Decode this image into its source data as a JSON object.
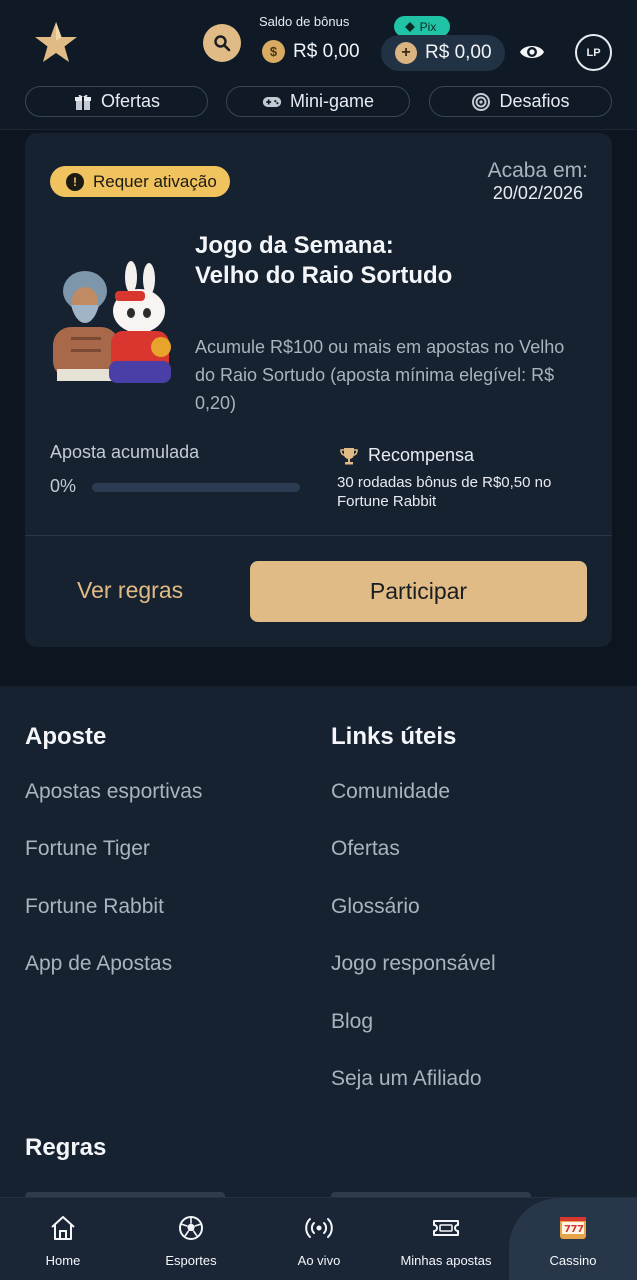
{
  "header": {
    "bonus_label": "Saldo de bônus",
    "bonus_value": "R$ 0,00",
    "pix_label": "Pix",
    "balance_value": "R$ 0,00",
    "avatar_initials": "LP",
    "tabs": [
      {
        "label": "Ofertas",
        "icon": "gift-icon"
      },
      {
        "label": "Mini-game",
        "icon": "gamepad-icon"
      },
      {
        "label": "Desafios",
        "icon": "target-icon"
      }
    ]
  },
  "card": {
    "status_badge": "Requer ativação",
    "ends_label": "Acaba em:",
    "ends_date": "20/02/2026",
    "title_line1": "Jogo da Semana:",
    "title_line2": "Velho do Raio Sortudo",
    "description": "Acumule R$100 ou mais em apostas no Velho do Raio Sortudo (aposta mínima elegível: R$ 0,20)",
    "accumulated_label": "Aposta acumulada",
    "progress_text": "0%",
    "progress_fraction": 0,
    "reward_label": "Recompensa",
    "reward_text": "30 rodadas bônus de R$0,50 no Fortune Rabbit",
    "rules_link": "Ver regras",
    "join_button": "Participar"
  },
  "footer": {
    "col1_title": "Aposte",
    "col1_links": [
      "Apostas esportivas",
      "Fortune Tiger",
      "Fortune Rabbit",
      "App de Apostas"
    ],
    "col2_title": "Links úteis",
    "col2_links": [
      "Comunidade",
      "Ofertas",
      "Glossário",
      "Jogo responsável",
      "Blog",
      "Seja um Afiliado"
    ],
    "rules_title": "Regras"
  },
  "bottom_nav": [
    {
      "label": "Home",
      "icon": "home-icon"
    },
    {
      "label": "Esportes",
      "icon": "soccer-ball-icon"
    },
    {
      "label": "Ao vivo",
      "icon": "live-broadcast-icon"
    },
    {
      "label": "Minhas apostas",
      "icon": "ticket-icon"
    },
    {
      "label": "Cassino",
      "icon": "slot-machine-icon",
      "active": true
    }
  ],
  "colors": {
    "accent": "#e0bb85",
    "background": "#0d1520",
    "card": "#172231",
    "warning": "#f0c35e",
    "pix": "#20c3a6"
  }
}
